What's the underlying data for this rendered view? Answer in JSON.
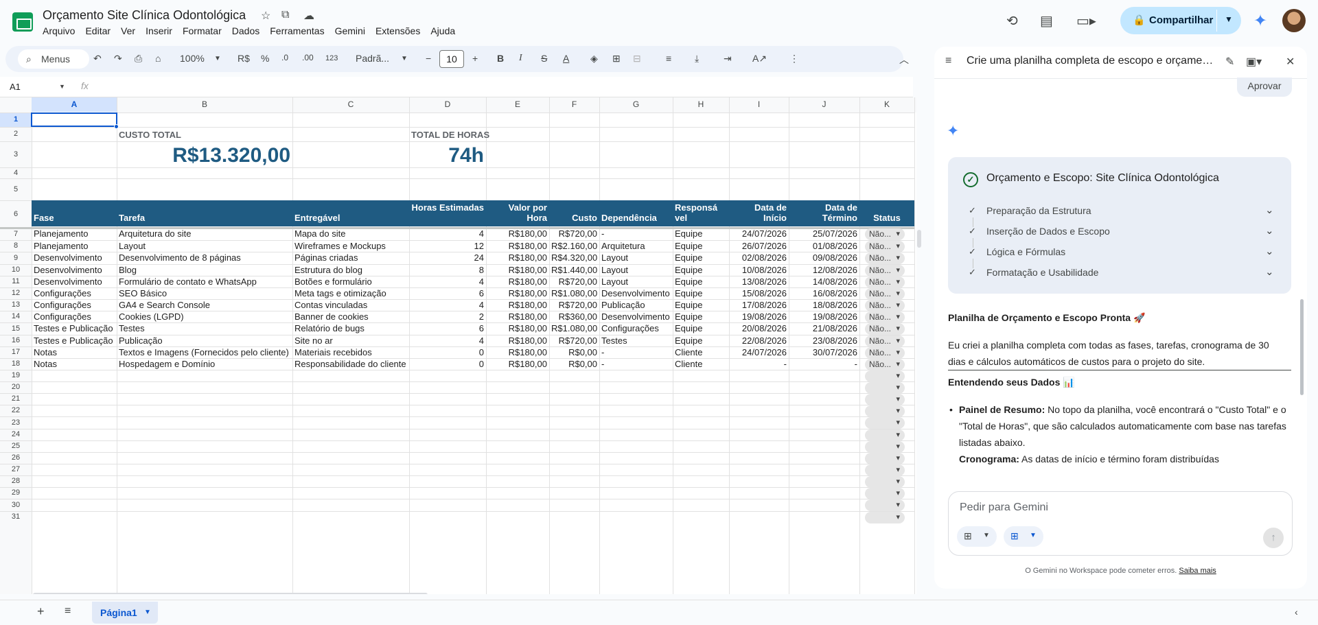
{
  "header": {
    "title": "Orçamento Site Clínica Odontológica",
    "menu": [
      "Arquivo",
      "Editar",
      "Ver",
      "Inserir",
      "Formatar",
      "Dados",
      "Ferramentas",
      "Gemini",
      "Extensões",
      "Ajuda"
    ],
    "share_label": "Compartilhar"
  },
  "toolbar": {
    "search_label": "Menus",
    "zoom": "100%",
    "currency": "R$",
    "percent": "%",
    "dec_decrease": ".0",
    "dec_increase": ".00",
    "number_format": "123",
    "font": "Padrã...",
    "font_size": "10"
  },
  "formula_bar": {
    "cell_ref": "A1",
    "fx": "fx"
  },
  "grid": {
    "columns": [
      "A",
      "B",
      "C",
      "D",
      "E",
      "F",
      "G",
      "H",
      "I",
      "J",
      "K"
    ],
    "summary": {
      "cost_label": "CUSTO TOTAL",
      "cost_value": "R$13.320,00",
      "hours_label": "TOTAL DE HORAS",
      "hours_value": "74h"
    },
    "headers": [
      "Fase",
      "Tarefa",
      "Entregável",
      "Horas Estimadas",
      "Valor por Hora",
      "Custo",
      "Dependência",
      "Responsá vel",
      "Data de Início",
      "Data de Término",
      "Status"
    ],
    "rows": [
      [
        "Planejamento",
        "Arquitetura do site",
        "Mapa do site",
        "4",
        "R$180,00",
        "R$720,00",
        "-",
        "Equipe",
        "24/07/2026",
        "25/07/2026",
        "Não..."
      ],
      [
        "Planejamento",
        "Layout",
        "Wireframes e Mockups",
        "12",
        "R$180,00",
        "R$2.160,00",
        "Arquitetura",
        "Equipe",
        "26/07/2026",
        "01/08/2026",
        "Não..."
      ],
      [
        "Desenvolvimento",
        "Desenvolvimento de 8 páginas",
        "Páginas criadas",
        "24",
        "R$180,00",
        "R$4.320,00",
        "Layout",
        "Equipe",
        "02/08/2026",
        "09/08/2026",
        "Não..."
      ],
      [
        "Desenvolvimento",
        "Blog",
        "Estrutura do blog",
        "8",
        "R$180,00",
        "R$1.440,00",
        "Layout",
        "Equipe",
        "10/08/2026",
        "12/08/2026",
        "Não..."
      ],
      [
        "Desenvolvimento",
        "Formulário de contato e WhatsApp",
        "Botões e formulário",
        "4",
        "R$180,00",
        "R$720,00",
        "Layout",
        "Equipe",
        "13/08/2026",
        "14/08/2026",
        "Não..."
      ],
      [
        "Configurações",
        "SEO Básico",
        "Meta tags e otimização",
        "6",
        "R$180,00",
        "R$1.080,00",
        "Desenvolvimento",
        "Equipe",
        "15/08/2026",
        "16/08/2026",
        "Não..."
      ],
      [
        "Configurações",
        "GA4 e Search Console",
        "Contas vinculadas",
        "4",
        "R$180,00",
        "R$720,00",
        "Publicação",
        "Equipe",
        "17/08/2026",
        "18/08/2026",
        "Não..."
      ],
      [
        "Configurações",
        "Cookies (LGPD)",
        "Banner de cookies",
        "2",
        "R$180,00",
        "R$360,00",
        "Desenvolvimento",
        "Equipe",
        "19/08/2026",
        "19/08/2026",
        "Não..."
      ],
      [
        "Testes e Publicação",
        "Testes",
        "Relatório de bugs",
        "6",
        "R$180,00",
        "R$1.080,00",
        "Configurações",
        "Equipe",
        "20/08/2026",
        "21/08/2026",
        "Não..."
      ],
      [
        "Testes e Publicação",
        "Publicação",
        "Site no ar",
        "4",
        "R$180,00",
        "R$720,00",
        "Testes",
        "Equipe",
        "22/08/2026",
        "23/08/2026",
        "Não..."
      ],
      [
        "Notas",
        "Textos e Imagens (Fornecidos pelo cliente)",
        "Materiais recebidos",
        "0",
        "R$180,00",
        "R$0,00",
        "-",
        "Cliente",
        "24/07/2026",
        "30/07/2026",
        "Não..."
      ],
      [
        "Notas",
        "Hospedagem e Domínio",
        "Responsabilidade do cliente",
        "0",
        "R$180,00",
        "R$0,00",
        "-",
        "Cliente",
        "-",
        "-",
        "Não..."
      ]
    ],
    "row_numbers": [
      "1",
      "2",
      "3",
      "4",
      "5",
      "6",
      "7",
      "8",
      "9",
      "10",
      "11",
      "12",
      "13",
      "14",
      "15",
      "16",
      "17",
      "18",
      "19",
      "20",
      "21",
      "22",
      "23",
      "24",
      "25",
      "26",
      "27",
      "28",
      "29",
      "30",
      "31"
    ]
  },
  "sheet_tabs": {
    "active": "Página1"
  },
  "gemini": {
    "panel_title": "Crie uma planilha completa de escopo e orçamento",
    "approve_label": "Aprovar",
    "card_title": "Orçamento e Escopo: Site Clínica Odontológica",
    "steps": [
      "Preparação da Estrutura",
      "Inserção de Dados e Escopo",
      "Lógica e Fórmulas",
      "Formatação e Usabilidade"
    ],
    "response_heading": "Planilha de Orçamento e Escopo Pronta 🚀",
    "response_paragraph": "Eu criei a planilha completa com todas as fases, tarefas, cronograma de 30 dias e cálculos automáticos de custos para o projeto do site.",
    "response_heading2": "Entendendo seus Dados 📊",
    "bullet1_bold": "Painel de Resumo:",
    "bullet1_text": " No topo da planilha, você encontrará o \"Custo Total\" e o \"Total de Horas\", que são calculados automaticamente com base nas tarefas listadas abaixo.",
    "bullet2_bold": "Cronograma:",
    "bullet2_text": " As datas de início e término foram distribuídas",
    "prompt_placeholder": "Pedir para Gemini",
    "disclaimer": "O Gemini no Workspace pode cometer erros.",
    "disclaimer_link": "Saiba mais"
  },
  "colors": {
    "header_fill": "#1f5b82",
    "summary_value": "#1f5b82",
    "accent": "#0b57d0",
    "share_bg": "#c2e7ff"
  }
}
